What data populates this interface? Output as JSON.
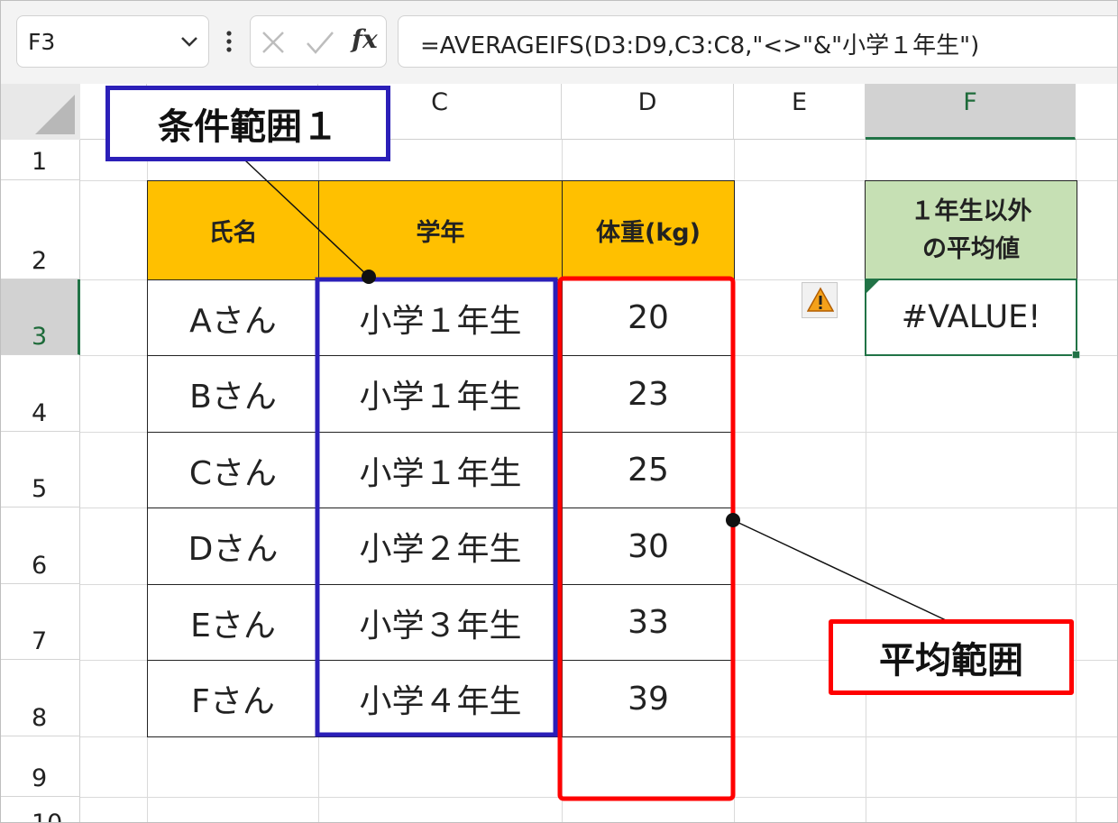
{
  "formula_bar": {
    "name_box": "F3",
    "cancel_icon": "x-icon",
    "enter_icon": "check-icon",
    "fx_label": "fx",
    "formula": "=AVERAGEIFS(D3:D9,C3:C8,\"<>\"&\"小学１年生\")"
  },
  "columns": [
    "C",
    "D",
    "E",
    "F"
  ],
  "rows": [
    "1",
    "2",
    "3",
    "4",
    "5",
    "6",
    "7",
    "8",
    "9",
    "10"
  ],
  "table": {
    "headers": [
      "氏名",
      "学年",
      "体重(kg)"
    ],
    "rows": [
      [
        "Aさん",
        "小学１年生",
        "20"
      ],
      [
        "Bさん",
        "小学１年生",
        "23"
      ],
      [
        "Cさん",
        "小学１年生",
        "25"
      ],
      [
        "Dさん",
        "小学２年生",
        "30"
      ],
      [
        "Eさん",
        "小学３年生",
        "33"
      ],
      [
        "Fさん",
        "小学４年生",
        "39"
      ]
    ]
  },
  "result": {
    "header_line1": "１年生以外",
    "header_line2": "の平均値",
    "value": "#VALUE!"
  },
  "annotations": {
    "criteria_range_label": "条件範囲１",
    "average_range_label": "平均範囲",
    "criteria_color": "#2b1fb8",
    "average_color": "#ff0000"
  },
  "colors": {
    "header_fill": "#ffc000",
    "result_header_fill": "#c6e0b4",
    "selection_green": "#217346"
  }
}
